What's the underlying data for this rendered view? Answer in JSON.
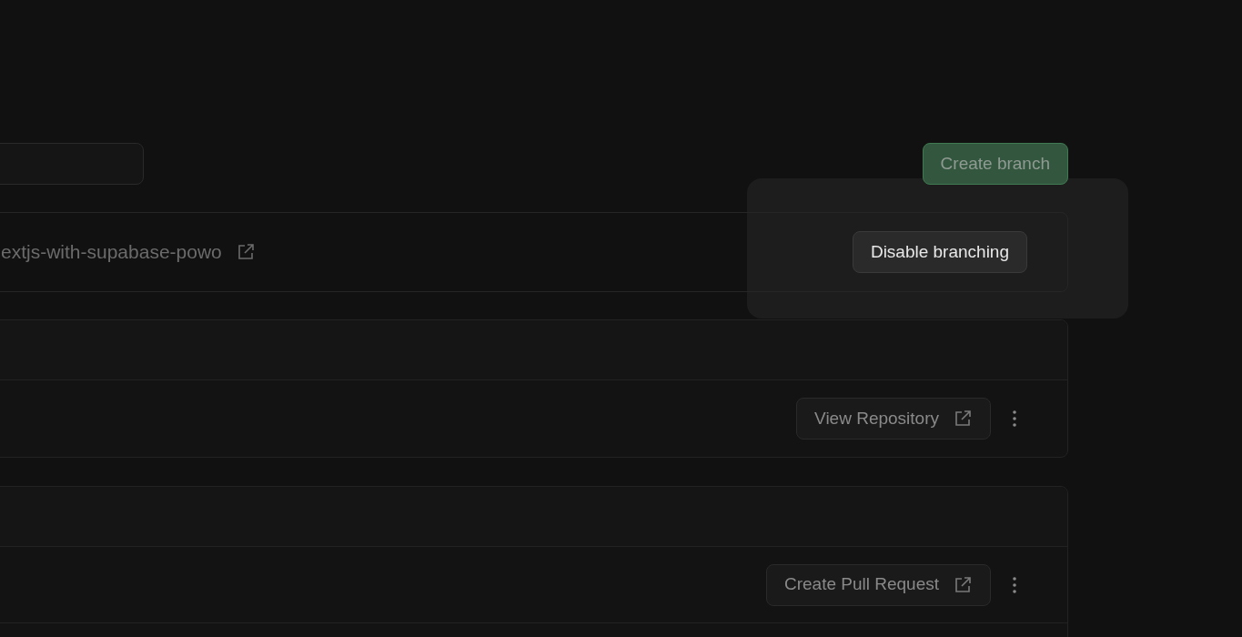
{
  "toolbar": {
    "create_button": "Create branch"
  },
  "repo_card": {
    "repository": "extjs-with-supabase-powo",
    "popover_button": "Disable branching"
  },
  "branches": [
    {
      "action": "View Repository"
    },
    {
      "action": "Create Pull Request"
    }
  ]
}
